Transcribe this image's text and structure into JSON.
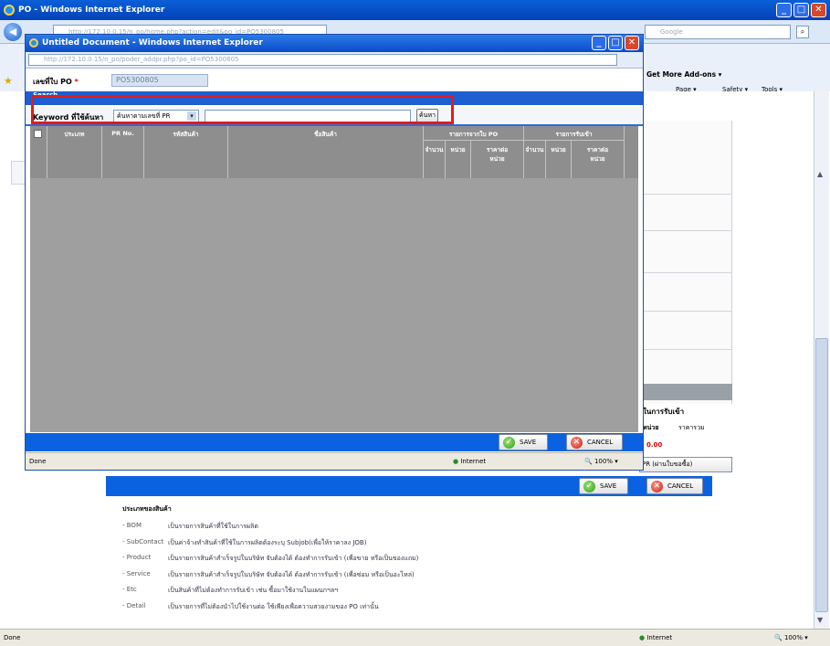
{
  "outer": {
    "title": "PO - Windows Internet Explorer",
    "url": "http://172.10.0.15/n_po/home.php?action=edit&po_id=PO5300805",
    "search_engine": "Google",
    "fav": {
      "get_addons": "Get More Add-ons",
      "page": "Page",
      "safety": "Safety",
      "tools": "Tools"
    },
    "status_done": "Done",
    "status_zone": "Internet",
    "zoom": "100%"
  },
  "popup": {
    "title": "Untitled Document - Windows Internet Explorer",
    "url": "http://172.10.0.15/n_po/poder_addpr.php?po_id=PO5300805",
    "po_label": "เลขที่ใบ PO",
    "required_mark": "*",
    "po_value": "PO5300805",
    "search_header": "Search",
    "keyword_label": "Keyword ที่ใช้ค้นหา",
    "select_value": "ค้นหาตามเลขที่ PR",
    "search_button": "ค้นหา",
    "columns": [
      "ประเภท",
      "PR No.",
      "รหัสสินค้า",
      "ชื่อสินค้า"
    ],
    "group_po": "รายการจากใบ PO",
    "group_recv": "รายการรับเข้า",
    "sub_cols": [
      "จำนวน",
      "หน่วย",
      "ราคาต่อหน่วย",
      "จำนวน",
      "หน่วย",
      "ราคาต่อหน่วย"
    ],
    "save": "SAVE",
    "cancel": "CANCEL",
    "status_done": "Done",
    "status_zone": "Internet",
    "zoom": "100%"
  },
  "background": {
    "recv_header": "ในการรับเข้า",
    "col_unit": "หน่วย",
    "col_price": "ราคารวม",
    "price_value": "0.00",
    "add_pr_button": "PR (ผ่านใบขอซื้อ)",
    "save": "SAVE",
    "cancel": "CANCEL",
    "legend_title": "ประเภทของสินค้า",
    "legend": [
      {
        "key": "- BOM",
        "desc": "เป็นรายการสินค้าที่ใช้ในการผลิต"
      },
      {
        "key": "- SubContact",
        "desc": "เป็นค่าจ้างทำสินค้าที่ใช้ในการผลิตต้องระบุ Subjob(เพื่อให้ราคาลง JOB)"
      },
      {
        "key": "- Product",
        "desc": "เป็นรายการสินค้าสำเร็จรูปในบริษัท จับต้องได้ ต้องทำการรับเข้า (เพื่อขาย หรือเป็นของแถม)"
      },
      {
        "key": "- Service",
        "desc": "เป็นรายการสินค้าสำเร็จรูปในบริษัท จับต้องได้ ต้องทำการรับเข้า (เพื่อซ่อม หรือเป็นอะไหล่)"
      },
      {
        "key": "- Etc",
        "desc": "เป็นสินค้าที่ไม่ต้องทำการรับเข้า เช่น ซื้อมาใช้งานในแผนกฯลฯ"
      },
      {
        "key": "- Detail",
        "desc": "เป็นรายการที่ไม่ต้องนำไปใช้งานต่อ ใช้เพียงเพื่อความสวยงามของ PO เท่านั้น"
      }
    ]
  }
}
